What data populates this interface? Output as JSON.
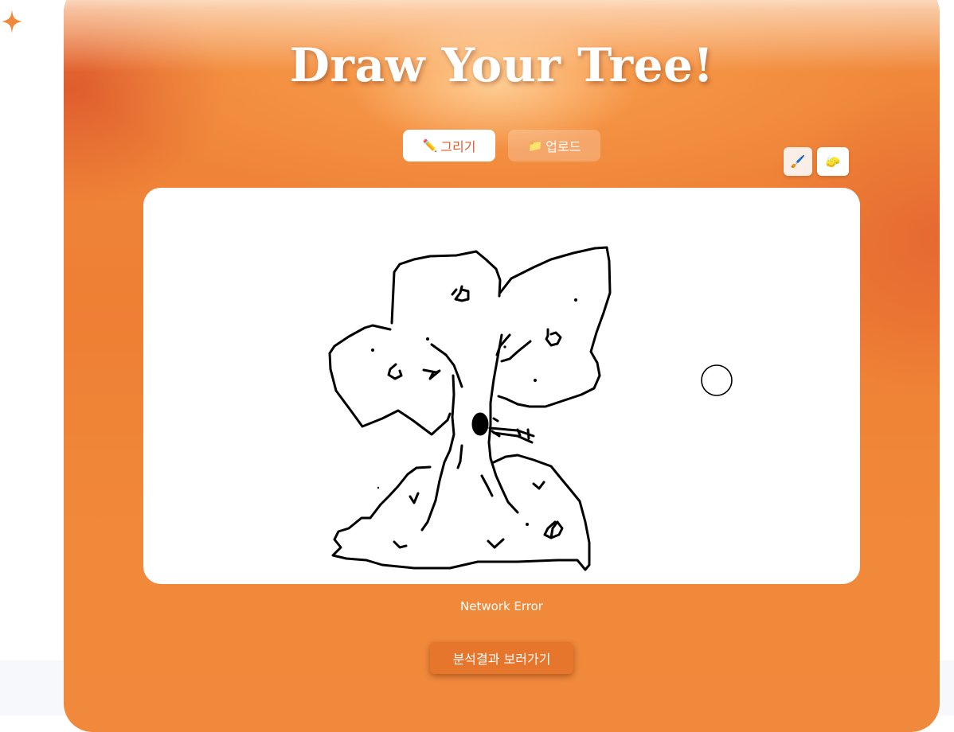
{
  "header": {
    "title": "Draw Your Tree!"
  },
  "tabs": [
    {
      "icon": "✏️",
      "label": "그리기",
      "active": true
    },
    {
      "icon": "📁",
      "label": "업로드",
      "active": false
    }
  ],
  "tools": {
    "brush_icon": "🖌️",
    "eraser_icon": "🧽"
  },
  "status": {
    "message": "Network Error"
  },
  "actions": {
    "result_label": "분석결과 보러가기"
  },
  "colors": {
    "accent": "#ee7f34",
    "tab_active_text": "#e05a2b",
    "result_button": "#e6762c",
    "sparkle": "#f0883a"
  }
}
